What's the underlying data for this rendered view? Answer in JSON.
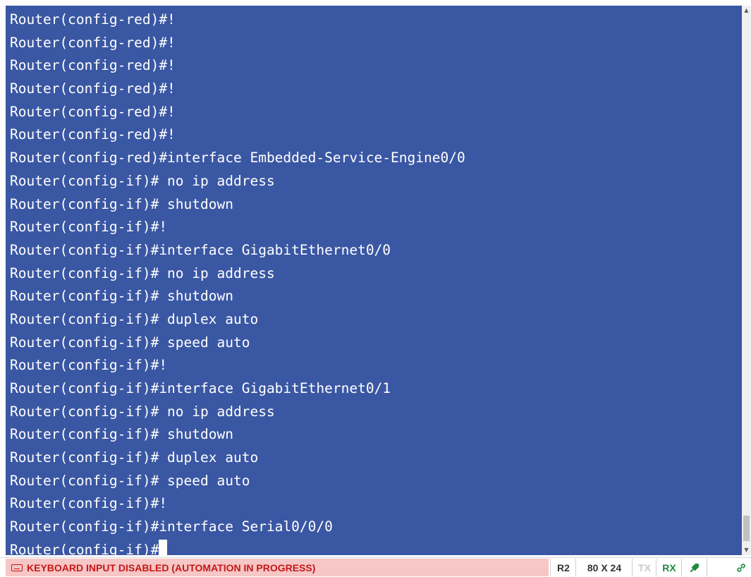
{
  "terminal": {
    "lines": [
      "Router(config-red)#!",
      "Router(config-red)#!",
      "Router(config-red)#!",
      "Router(config-red)#!",
      "Router(config-red)#!",
      "Router(config-red)#!",
      "Router(config-red)#interface Embedded-Service-Engine0/0",
      "Router(config-if)# no ip address",
      "Router(config-if)# shutdown",
      "Router(config-if)#!",
      "Router(config-if)#interface GigabitEthernet0/0",
      "Router(config-if)# no ip address",
      "Router(config-if)# shutdown",
      "Router(config-if)# duplex auto",
      "Router(config-if)# speed auto",
      "Router(config-if)#!",
      "Router(config-if)#interface GigabitEthernet0/1",
      "Router(config-if)# no ip address",
      "Router(config-if)# shutdown",
      "Router(config-if)# duplex auto",
      "Router(config-if)# speed auto",
      "Router(config-if)#!",
      "Router(config-if)#interface Serial0/0/0"
    ],
    "prompt": "Router(config-if)#",
    "background_color": "#3a57a3",
    "text_color": "#ffffff"
  },
  "scrollbar": {
    "up_icon": "scroll-up-arrow-icon",
    "down_icon": "scroll-down-arrow-icon"
  },
  "status_bar": {
    "message": "KEYBOARD INPUT DISABLED (AUTOMATION IN PROGRESS)",
    "message_icon": "keyboard-icon",
    "message_color": "#c41818",
    "message_bg": "#f7c6c6",
    "device": "R2",
    "dimensions": "80 X 24",
    "tx": "TX",
    "rx": "RX",
    "plug_icon": "plug-connected-icon",
    "link_icon": "link-icon",
    "tx_color": "#c8c8c8",
    "rx_color": "#1f8a3c"
  }
}
